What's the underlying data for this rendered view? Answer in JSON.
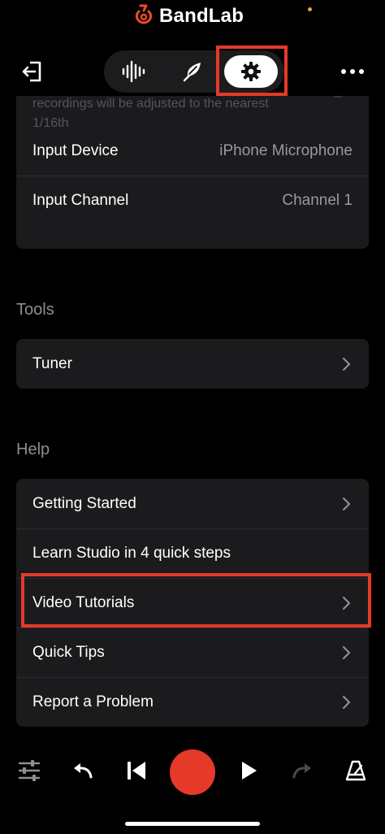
{
  "app": {
    "brand": "BandLab"
  },
  "topbar": {
    "exit_icon": "exit-icon",
    "tabs": [
      {
        "name": "waveform",
        "icon": "waveform-icon",
        "active": false
      },
      {
        "name": "lyrics",
        "icon": "feather-icon",
        "active": false
      },
      {
        "name": "settings",
        "icon": "gear-icon",
        "active": true
      }
    ],
    "more_icon": "more-icon"
  },
  "recording": {
    "note": "recordings will be adjusted to the nearest 1/16th",
    "rows": [
      {
        "label": "Input Device",
        "value": "iPhone Microphone"
      },
      {
        "label": "Input Channel",
        "value": "Channel 1"
      }
    ]
  },
  "tools": {
    "title": "Tools",
    "items": [
      {
        "label": "Tuner",
        "chevron": true
      }
    ]
  },
  "help": {
    "title": "Help",
    "items": [
      {
        "label": "Getting Started",
        "chevron": true
      },
      {
        "label": "Learn Studio in 4 quick steps",
        "chevron": false
      },
      {
        "label": "Video Tutorials",
        "chevron": true
      },
      {
        "label": "Quick Tips",
        "chevron": true
      },
      {
        "label": "Report a Problem",
        "chevron": true
      }
    ]
  },
  "transport": {
    "icons": [
      "mixer-icon",
      "undo-icon",
      "skip-back-icon",
      "record-icon",
      "play-icon",
      "redo-icon",
      "metronome-icon"
    ]
  },
  "colors": {
    "accent": "#e5392a",
    "card": "#1b1b1d",
    "muted": "#9a9a9f"
  }
}
